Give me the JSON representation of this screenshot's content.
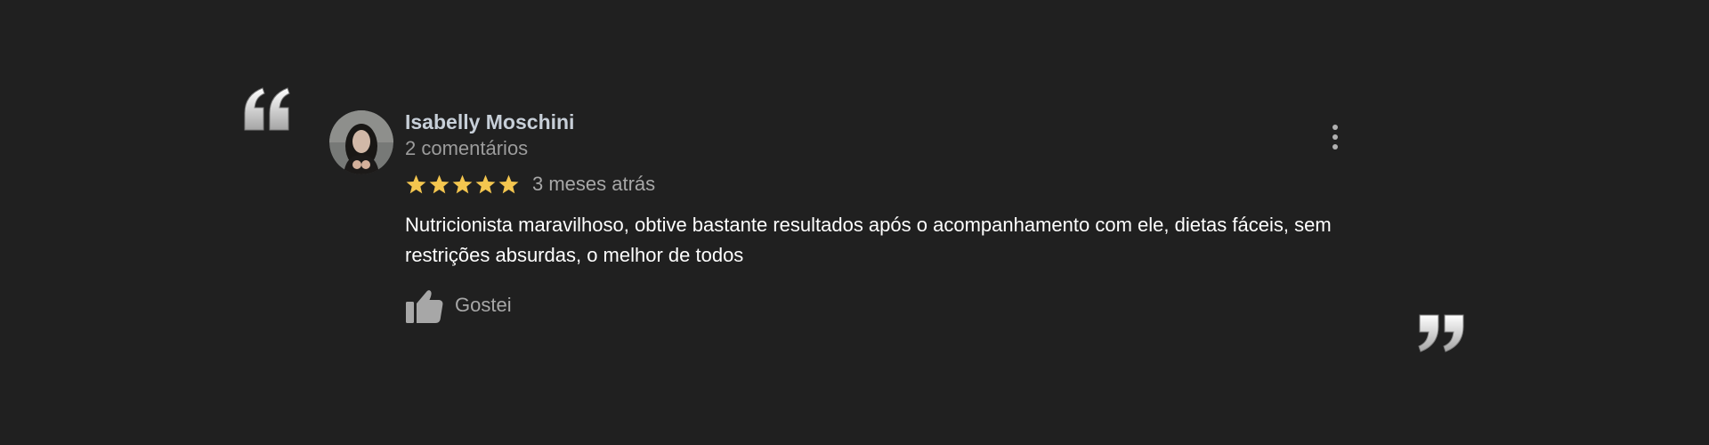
{
  "review": {
    "author_name": "Isabelly Moschini",
    "author_meta": "2 comentários",
    "rating": 5,
    "rating_max": 5,
    "date": "3 meses atrás",
    "text": "Nutricionista maravilhoso, obtive bastante resultados após o acompanhamento com ele, dietas fáceis, sem restrições absurdas, o melhor de todos",
    "like_label": "Gostei"
  },
  "icons": {
    "quote_open": "opening-quote-icon",
    "quote_close": "closing-quote-icon",
    "more": "more-vertical-icon",
    "star": "star-icon",
    "thumb": "thumbs-up-icon"
  },
  "colors": {
    "background": "#202020",
    "star": "#f4c64f",
    "author_name": "#c7cfd8",
    "muted_text": "#a7a7a7",
    "body_text": "#ffffff"
  }
}
